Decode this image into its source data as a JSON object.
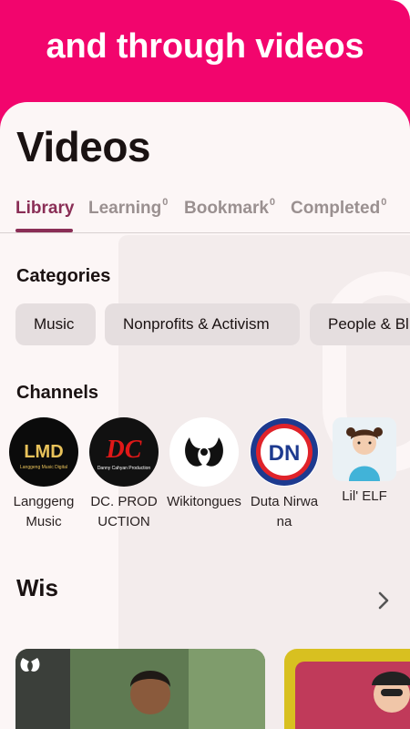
{
  "banner": {
    "text": "and through videos",
    "color": "#f2056d"
  },
  "page": {
    "title": "Videos"
  },
  "tabs": [
    {
      "label": "Library",
      "count": "",
      "active": true
    },
    {
      "label": "Learning",
      "count": "0",
      "active": false
    },
    {
      "label": "Bookmark",
      "count": "0",
      "active": false
    },
    {
      "label": "Completed",
      "count": "0",
      "active": false
    }
  ],
  "categories": {
    "heading": "Categories",
    "items": [
      "Music",
      "Nonprofits & Activism",
      "People & Bl"
    ]
  },
  "channels": {
    "heading": "Channels",
    "items": [
      {
        "name": "Langgeng Music",
        "logo_text": "LMD",
        "logo_sub": "Langgeng Music Digital"
      },
      {
        "name": "DC. PRODUCTION",
        "logo_text": "DC",
        "logo_sub": "Danny Cahyan Production"
      },
      {
        "name": "Wikitongues",
        "logo_text": "",
        "logo_sub": ""
      },
      {
        "name": "Duta Nirwana",
        "logo_text": "DN",
        "logo_sub": ""
      },
      {
        "name": "Lil' ELF",
        "logo_text": "",
        "logo_sub": ""
      }
    ]
  },
  "playlist": {
    "title": "Wis",
    "icon": "chevron-right-icon"
  },
  "colors": {
    "accent": "#8a2e56",
    "sheet": "#fcf6f6",
    "chip": "#e5dedf"
  }
}
